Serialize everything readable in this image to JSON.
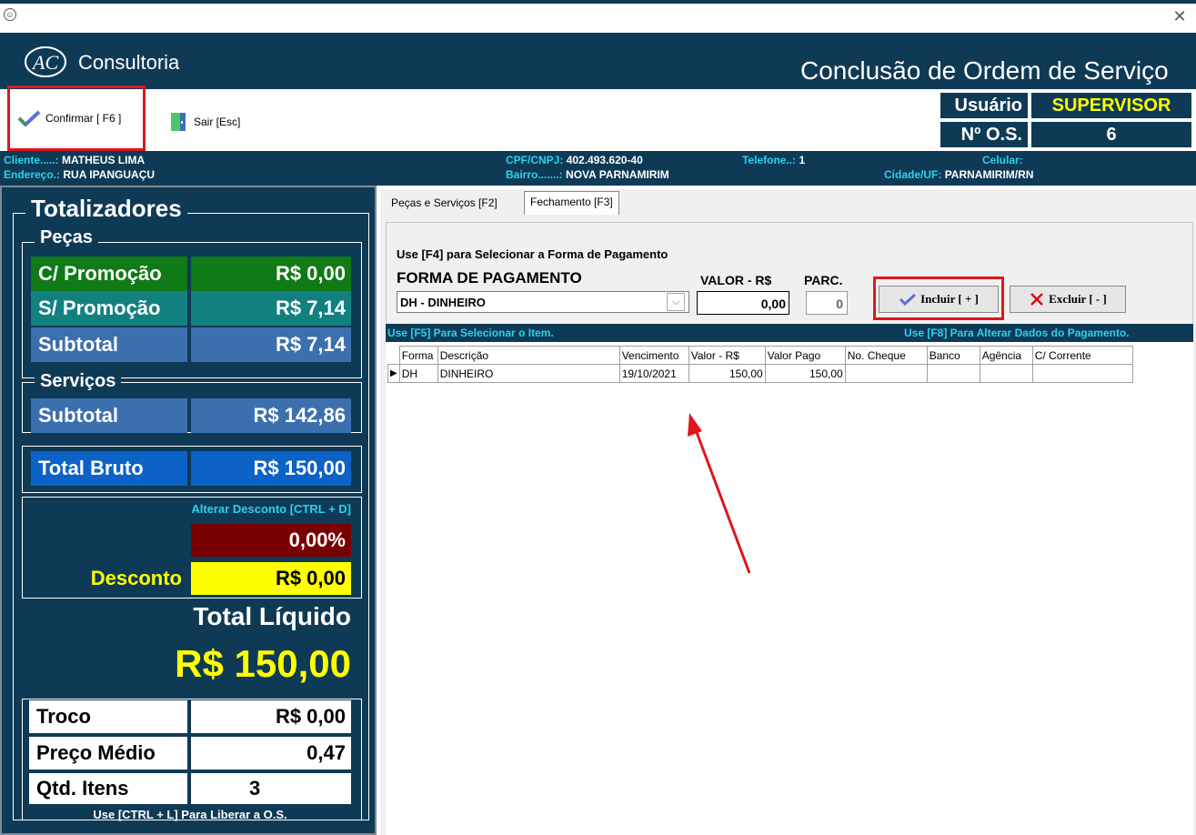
{
  "window": {
    "title_icon": "app-icon",
    "close_icon": "close-icon"
  },
  "header": {
    "brand": "Consultoria",
    "form_title": "Conclusão de Ordem de Serviço"
  },
  "toolbar": {
    "confirm_label": "Confirmar [ F6 ]",
    "exit_label": "Sair [Esc]",
    "user_label": "Usuário",
    "user_value": "SUPERVISOR",
    "os_label": "Nº O.S.",
    "os_value": "6"
  },
  "client": {
    "cliente_label": "Cliente.....:",
    "cliente_value": "MATHEUS LIMA",
    "endereco_label": "Endereço.:",
    "endereco_value": "RUA IPANGUAÇU",
    "cpf_label": "CPF/CNPJ:",
    "cpf_value": "402.493.620-40",
    "bairro_label": "Bairro.......:",
    "bairro_value": "NOVA PARNAMIRIM",
    "telefone_label": "Telefone..:",
    "telefone_value": "1",
    "celular_label": "Celular:",
    "celular_value": "",
    "cidade_label": "Cidade/UF:",
    "cidade_value": "PARNAMIRIM/RN"
  },
  "totals": {
    "title": "Totalizadores",
    "pecas_title": "Peças",
    "c_promo_label": "C/ Promoção",
    "c_promo_value": "R$ 0,00",
    "s_promo_label": "S/ Promoção",
    "s_promo_value": "R$ 7,14",
    "pecas_subtotal_label": "Subtotal",
    "pecas_subtotal_value": "R$ 7,14",
    "servicos_title": "Serviços",
    "serv_subtotal_label": "Subtotal",
    "serv_subtotal_value": "R$ 142,86",
    "bruto_label": "Total Bruto",
    "bruto_value": "R$ 150,00",
    "alterar_desconto": "Alterar Desconto [CTRL + D]",
    "desconto_pct": "0,00%",
    "desconto_label": "Desconto",
    "desconto_value": "R$ 0,00",
    "liquido_label": "Total Líquido",
    "liquido_value": "R$ 150,00",
    "troco_label": "Troco",
    "troco_value": "R$ 0,00",
    "preco_medio_label": "Preço Médio",
    "preco_medio_value": "0,47",
    "qtd_label": "Qtd. Itens",
    "qtd_value": "3",
    "liberar_hint": "Use [CTRL + L] Para Liberar a O.S."
  },
  "tabs": {
    "pecas": "Peças e Serviços [F2]",
    "fechamento": "Fechamento [F3]"
  },
  "payment": {
    "hint_f4": "Use [F4] para Selecionar a Forma de Pagamento",
    "forma_label": "FORMA DE PAGAMENTO",
    "forma_value": "DH - DINHEIRO",
    "valor_label": "VALOR - R$",
    "valor_value": "0,00",
    "parc_label": "PARC.",
    "parc_value": "0",
    "incluir_label": "Incluir [ + ]",
    "excluir_label": "Excluir [ - ]",
    "hint_f5": "Use [F5] Para Selecionar o Item.",
    "hint_f8": "Use [F8] Para Alterar Dados do Pagamento."
  },
  "grid": {
    "columns": [
      "Forma",
      "Descrição",
      "Vencimento",
      "Valor - R$",
      "Valor Pago",
      "No. Cheque",
      "Banco",
      "Agência",
      "C/ Corrente"
    ],
    "rows": [
      [
        "DH",
        "DINHEIRO",
        "19/10/2021",
        "150,00",
        "150,00",
        "",
        "",
        "",
        ""
      ]
    ]
  },
  "colors": {
    "navy": "#0f3a55",
    "red_highlight": "#e0161c",
    "yellow": "#ffff00",
    "cyan_text": "#29d2f0"
  }
}
